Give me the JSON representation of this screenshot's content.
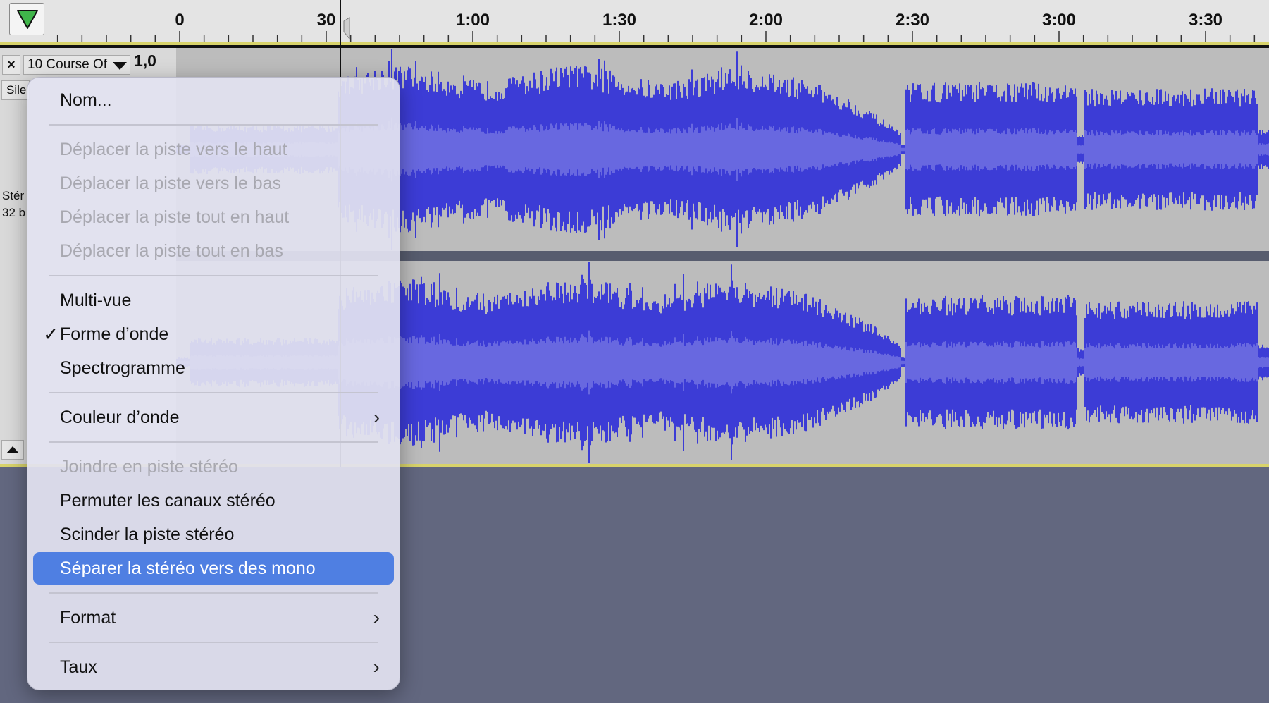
{
  "ruler": {
    "ticks": [
      "0",
      "30",
      "1:00",
      "1:30",
      "2:00",
      "2:30",
      "3:00",
      "3:30"
    ]
  },
  "track": {
    "close_label": "×",
    "name": "10 Course Of",
    "scale_label": "1,0",
    "mute_label_partial": "Sile",
    "info_line1": "Stér",
    "info_line2": "32 b"
  },
  "menu": {
    "items": [
      {
        "label": "Nom...",
        "enabled": true
      },
      {
        "label": "Déplacer la piste vers le haut",
        "enabled": false
      },
      {
        "label": "Déplacer la piste vers le bas",
        "enabled": false
      },
      {
        "label": "Déplacer la piste tout en haut",
        "enabled": false
      },
      {
        "label": "Déplacer la piste tout en bas",
        "enabled": false
      },
      {
        "label": "Multi-vue",
        "enabled": true
      },
      {
        "label": "Forme d’onde",
        "enabled": true,
        "checked": true
      },
      {
        "label": "Spectrogramme",
        "enabled": true
      },
      {
        "label": "Couleur d’onde",
        "enabled": true,
        "submenu": true
      },
      {
        "label": "Joindre en piste stéréo",
        "enabled": false
      },
      {
        "label": "Permuter les canaux stéréo",
        "enabled": true
      },
      {
        "label": "Scinder la piste stéréo",
        "enabled": true
      },
      {
        "label": "Séparer la stéréo vers des mono",
        "enabled": true,
        "highlighted": true
      },
      {
        "label": "Format",
        "enabled": true,
        "submenu": true
      },
      {
        "label": "Taux",
        "enabled": true,
        "submenu": true
      }
    ],
    "check_glyph": "✓",
    "chevron_glyph": "›"
  },
  "colors": {
    "wave_dark": "#3c3cd6",
    "wave_light": "#6868e0",
    "wave_bg": "#bcbcbc",
    "highlight": "#4f7fe2",
    "background": "#62677f"
  },
  "icons": {
    "play": "play-triangle-icon",
    "close": "close-icon",
    "dropdown": "chevron-down-icon",
    "collapse": "collapse-up-icon"
  }
}
